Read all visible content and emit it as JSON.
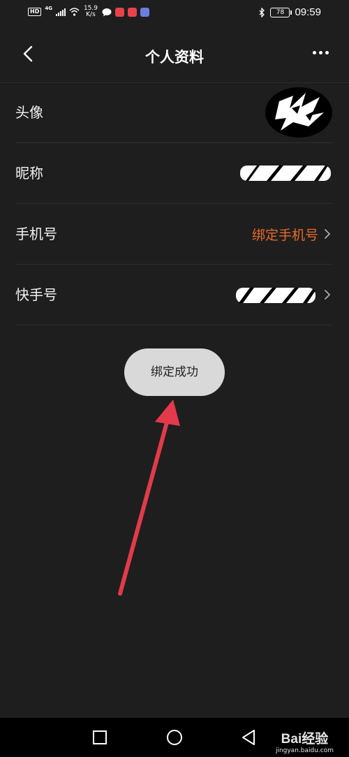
{
  "status_bar": {
    "network": "HD",
    "network_type": "4G",
    "speed_value": "15.9",
    "speed_unit": "K/s",
    "battery": "78",
    "time": "09:59"
  },
  "header": {
    "title": "个人资料"
  },
  "rows": [
    {
      "label": "头像"
    },
    {
      "label": "昵称"
    },
    {
      "label": "手机号",
      "value": "绑定手机号"
    },
    {
      "label": "快手号"
    }
  ],
  "toast": {
    "message": "绑定成功"
  },
  "watermark": {
    "logo": "Bai经验",
    "url": "jingyan.baidu.com"
  },
  "colors": {
    "background": "#1e1e1e",
    "accent_orange": "#e8692a",
    "toast_bg": "#d9d9d9",
    "arrow_red": "#e23a4a"
  }
}
